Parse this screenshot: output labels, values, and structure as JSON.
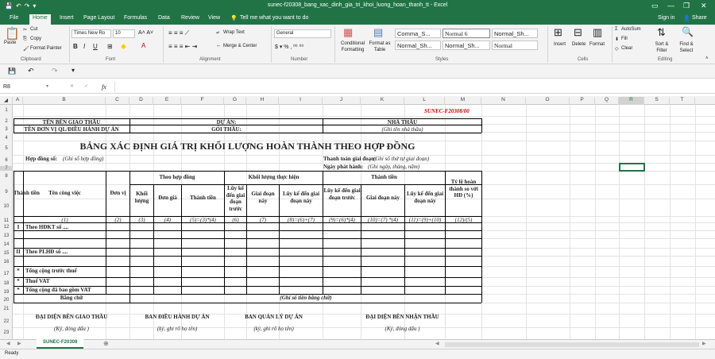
{
  "window": {
    "title": "sunec-f20308_bang_xac_dinh_gia_tri_khoi_luong_hoan_thanh_tt - Excel"
  },
  "tabs": [
    "File",
    "Home",
    "Insert",
    "Page Layout",
    "Formulas",
    "Data",
    "Review",
    "View"
  ],
  "tell_me": "Tell me what you want to do",
  "signin": "Sign in",
  "share": "Share",
  "ribbon": {
    "clipboard": {
      "paste": "Paste",
      "cut": "Cut",
      "copy": "Copy",
      "format_painter": "Format Painter",
      "label": "Clipboard"
    },
    "font": {
      "name": "Times New Ro",
      "size": "10",
      "label": "Font"
    },
    "alignment": {
      "wrap": "Wrap Text",
      "merge": "Merge & Center",
      "label": "Alignment"
    },
    "number": {
      "format": "General",
      "label": "Number"
    },
    "styles": {
      "conditional": "Conditional Formatting",
      "format_table": "Format as Table",
      "cells": [
        "Comma_S...",
        "Normal 6",
        "Normal_Sh...",
        "Normal_Sh...",
        "Normal_Sh...",
        "Normal"
      ],
      "label": "Styles"
    },
    "cells": {
      "insert": "Insert",
      "delete": "Delete",
      "format": "Format",
      "label": "Cells"
    },
    "editing": {
      "autosum": "AutoSum",
      "fill": "Fill",
      "clear": "Clear",
      "sort": "Sort & Filter",
      "find": "Find & Select",
      "label": "Editing"
    }
  },
  "namebox": "R8",
  "fx": "fx",
  "columns": [
    "A",
    "B",
    "C",
    "D",
    "E",
    "F",
    "G",
    "H",
    "I",
    "J",
    "K",
    "L",
    "M",
    "N",
    "O",
    "P",
    "Q",
    "R",
    "S",
    "T"
  ],
  "rows": [
    "1",
    "2",
    "3",
    "4",
    "5",
    "6",
    "7",
    "8",
    "9",
    "10",
    "11",
    "12",
    "13",
    "14",
    "15",
    "16",
    "17",
    "18",
    "19",
    "20",
    "21",
    "22",
    "23"
  ],
  "sheet": {
    "code": "SUNEC-F20308/00",
    "r2": {
      "a": "TÊN BÊN GIAO THẦU",
      "b": "DỰ ÁN:",
      "c": "NHÀ THẦU"
    },
    "r3": {
      "a": "TÊN ĐƠN VỊ QL/ĐIỀU HÀNH DỰ ÁN",
      "b": "GÓI THẦU:",
      "c": "(Ghi tên nhà thầu)"
    },
    "title": "BẢNG XÁC ĐỊNH GIÁ TRỊ KHỐI LƯỢNG HOÀN THÀNH THEO HỢP ĐỒNG",
    "contract_label": "Hợp đồng số:",
    "contract_note": "(Ghi số hợp đồng)",
    "pay_label": "Thanh toán giai đoạn:",
    "pay_note": "(Ghi số thứ tự giai đoạn)",
    "date_label": "Ngày phát hành:",
    "date_note": "(Ghi ngày, tháng, năm)",
    "hdr": {
      "tt": "Thành tiền",
      "ten": "Tên công việc",
      "dv": "Đơn vị",
      "theo_hd": "Theo hợp đồng",
      "kl_th": "Khối lượng thực hiện",
      "tt_tien": "Thành tiền",
      "tyle": "Tỷ lệ hoàn thành so với HĐ (%)",
      "kl": "Khối lượng",
      "dg": "Đơn giá",
      "lk_truoc": "Lũy kế đến giai đoạn trước",
      "gd_nay": "Giai đoạn này",
      "lk_nay": "Lũy kế đến giai đoạn này",
      "lk_truoc2": "Lũy kế đến giai đoạn trước",
      "gd_nay2": "Giai đoạn này",
      "lk_nay2": "Lũy kế đến giai đoạn này"
    },
    "r11": [
      "(1)",
      "(2)",
      "(3)",
      "(4)",
      "(5)=(3)*(4)",
      "(6)",
      "(7)",
      "(8)=(6)+(7)",
      "(9)=(6)*(4)",
      "(10)=(7) *(4)",
      "(11)=(9)+(10)",
      "(12)/(5)"
    ],
    "r13": {
      "tt": "I",
      "name": "Theo HĐKT số ...."
    },
    "r16": {
      "tt": "II",
      "name": "Theo PLHĐ số ...."
    },
    "r17": {
      "tt": "*",
      "name": "Tổng cộng trước thuế"
    },
    "r18": {
      "tt": "*",
      "name": "Thuế VAT"
    },
    "r19": {
      "tt": "*",
      "name": "Tổng cộng đã bao gồm VAT"
    },
    "r20": {
      "a": "Bằng chữ",
      "b": "(Ghi số tiền bằng chữ)"
    },
    "sign": {
      "a": "ĐẠI DIỆN BÊN GIAO THẦU",
      "b": "BAN ĐIỀU HÀNH DỰ ÁN",
      "c": "BAN QUẢN LÝ DỰ ÁN",
      "d": "ĐẠI DIỆN BÊN NHẬN THẦU",
      "a2": "(Ký, đóng dấu )",
      "b2": "(ký, ghi rõ họ tên)",
      "c2": "(ký, ghi rõ họ tên)",
      "d2": "(Ký, đóng dấu )"
    }
  },
  "sheet_tab": "SUNEC-F20308",
  "status": "Ready"
}
